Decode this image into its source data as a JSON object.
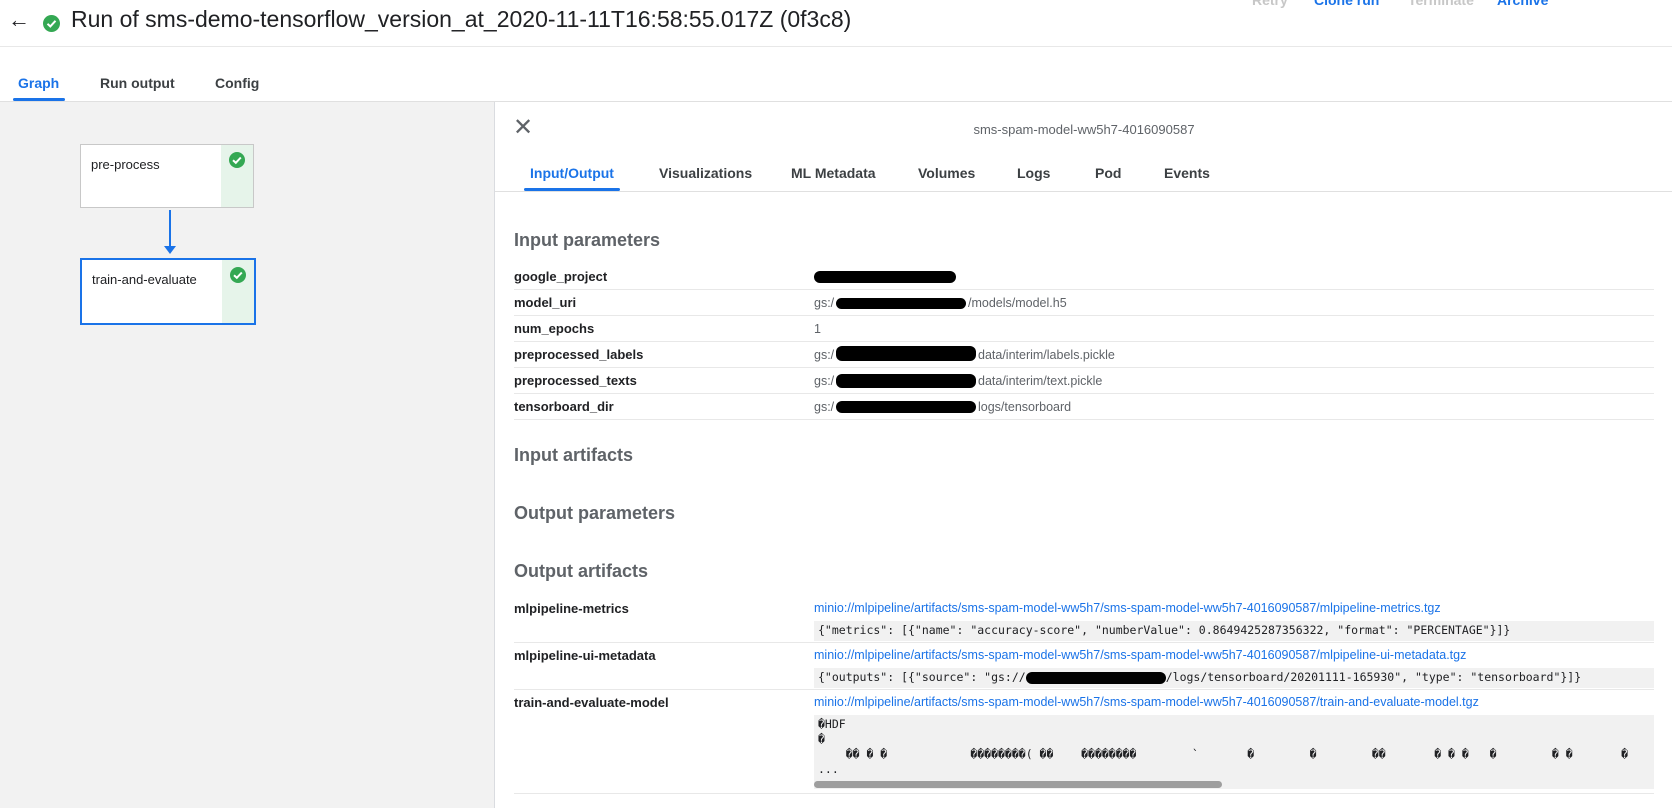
{
  "header": {
    "back_icon": "arrow-back-icon",
    "status_icon": "check-circle-icon",
    "title": "Run of sms-demo-tensorflow_version_at_2020-11-11T16:58:55.017Z (0f3c8)",
    "actions": {
      "retry": "Retry",
      "clone_run": "Clone run",
      "terminate": "Terminate",
      "archive": "Archive"
    }
  },
  "main_tabs": {
    "graph": "Graph",
    "run_output": "Run output",
    "config": "Config"
  },
  "graph": {
    "nodes": [
      {
        "label": "pre-process",
        "status_icon": "check-circle-icon"
      },
      {
        "label": "train-and-evaluate",
        "status_icon": "check-circle-icon"
      }
    ]
  },
  "panel": {
    "close_icon": "close-icon",
    "pod_name": "sms-spam-model-ww5h7-4016090587",
    "tabs": {
      "input_output": "Input/Output",
      "visualizations": "Visualizations",
      "ml_metadata": "ML Metadata",
      "volumes": "Volumes",
      "logs": "Logs",
      "pod": "Pod",
      "events": "Events"
    },
    "sections": {
      "input_parameters": "Input parameters",
      "input_artifacts": "Input artifacts",
      "output_parameters": "Output parameters",
      "output_artifacts": "Output artifacts"
    },
    "input_parameters": [
      {
        "key": "google_project",
        "value": ""
      },
      {
        "key": "model_uri",
        "value_prefix": "gs:/",
        "value_suffix": "/models/model.h5"
      },
      {
        "key": "num_epochs",
        "value": "1"
      },
      {
        "key": "preprocessed_labels",
        "value_prefix": "gs:/",
        "value_suffix": "data/interim/labels.pickle"
      },
      {
        "key": "preprocessed_texts",
        "value_prefix": "gs:/",
        "value_suffix": "data/interim/text.pickle"
      },
      {
        "key": "tensorboard_dir",
        "value_prefix": "gs:/",
        "value_suffix": "logs/tensorboard"
      }
    ],
    "output_artifacts": [
      {
        "key": "mlpipeline-metrics",
        "link": "minio://mlpipeline/artifacts/sms-spam-model-ww5h7/sms-spam-model-ww5h7-4016090587/mlpipeline-metrics.tgz",
        "preview": "{\"metrics\": [{\"name\": \"accuracy-score\", \"numberValue\": 0.8649425287356322, \"format\": \"PERCENTAGE\"}]}"
      },
      {
        "key": "mlpipeline-ui-metadata",
        "link": "minio://mlpipeline/artifacts/sms-spam-model-ww5h7/sms-spam-model-ww5h7-4016090587/mlpipeline-ui-metadata.tgz",
        "preview_prefix": "{\"outputs\": [{\"source\": \"gs://",
        "preview_suffix": "/logs/tensorboard/20201111-165930\", \"type\": \"tensorboard\"}]}"
      },
      {
        "key": "train-and-evaluate-model",
        "link": "minio://mlpipeline/artifacts/sms-spam-model-ww5h7/sms-spam-model-ww5h7-4016090587/train-and-evaluate-model.tgz",
        "preview_line1": "�HDF",
        "preview_line2": "�",
        "preview_line3": "    �� � �            ��������( ��    ��������        `       �        �        ��       � � �   �        � �       �",
        "preview_line4": "..."
      }
    ]
  },
  "colors": {
    "accent": "#1a73e8",
    "success": "#34a853",
    "graph_bg": "#f2f2f2"
  }
}
